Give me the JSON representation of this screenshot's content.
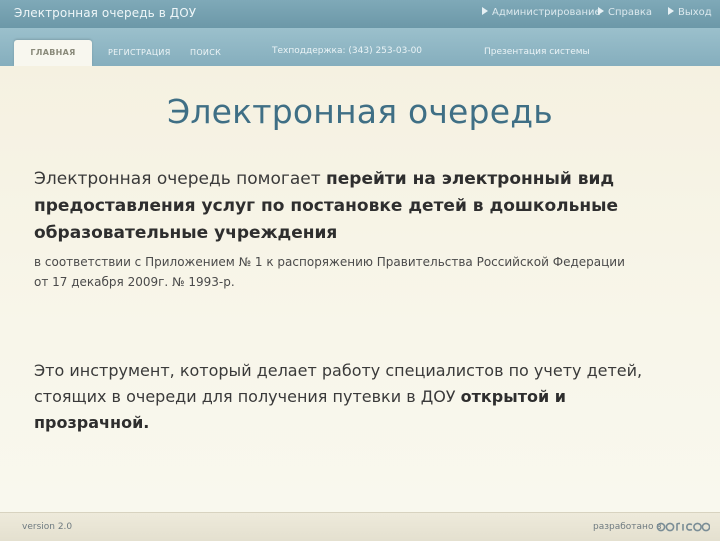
{
  "app": {
    "title": "Электронная очередь в ДОУ"
  },
  "top_links": {
    "admin": "Администрирование",
    "help": "Справка",
    "exit": "Выход"
  },
  "nav": {
    "tabs": [
      "ГЛАВНАЯ",
      "РЕГИСТРАЦИЯ",
      "ПОИСК"
    ],
    "active_tab": "ГЛАВНАЯ",
    "support": "Техподдержка: (343) 253-03-00",
    "presentation": "Презентация системы"
  },
  "content": {
    "heading": "Электронная очередь",
    "p1_intro": "Электронная очередь помогает ",
    "p1_bold": "перейти на электронный вид предоставления услуг по постановке детей в дошкольные образовательные учреждения",
    "p2": "в соответствии с Приложением № 1 к распоряжению Правительства Российской Федерации от 17 декабря 2009г. № 1993-р.",
    "p3_intro": "Это инструмент, который делает работу специалистов по учету детей, стоящих в очереди для получения путевки в ДОУ ",
    "p3_bold": "открытой и прозрачной."
  },
  "footer": {
    "version": "version 2.0",
    "developer": "разработано в",
    "logo_text": "ΩΓΙΣΟΦ"
  },
  "colors": {
    "topbar": "#7fa9b8",
    "navbar": "#9bc0cc",
    "heading": "#3f6f85",
    "background": "#f7f4e6"
  }
}
